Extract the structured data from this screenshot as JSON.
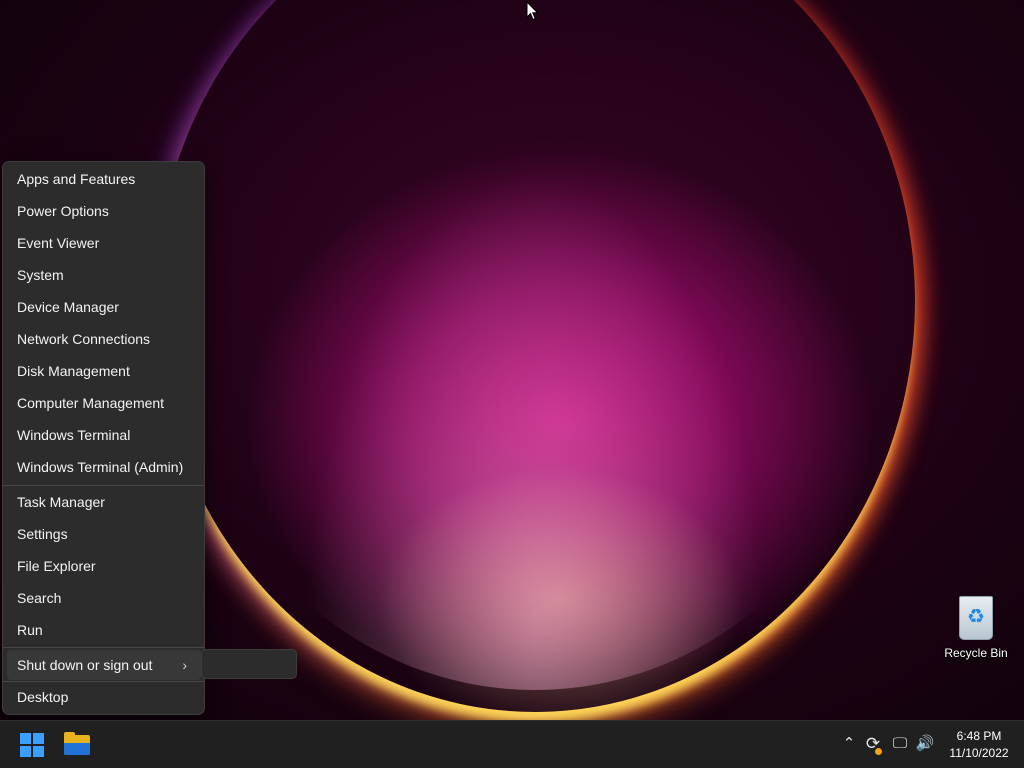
{
  "menu": {
    "group1": [
      "Apps and Features",
      "Power Options",
      "Event Viewer",
      "System",
      "Device Manager",
      "Network Connections",
      "Disk Management",
      "Computer Management",
      "Windows Terminal",
      "Windows Terminal (Admin)"
    ],
    "group2": [
      "Task Manager",
      "Settings",
      "File Explorer",
      "Search",
      "Run"
    ],
    "shutdown_label": "Shut down or sign out",
    "shutdown_chevron": "›",
    "desktop_label": "Desktop"
  },
  "desktop": {
    "recycle_bin_label": "Recycle Bin"
  },
  "taskbar": {
    "start_icon": "windows-logo-icon",
    "explorer_icon": "file-explorer-icon",
    "tray": {
      "chevron": "⌃",
      "sync": "⟳",
      "network": "🖵",
      "volume": "🔊"
    },
    "time": "6:48 PM",
    "date": "11/10/2022"
  },
  "colors": {
    "menu_bg": "#2c2c2c",
    "taskbar_bg": "#202020",
    "accent": "#3aa0ff",
    "sync_badge": "#f7a21b"
  }
}
